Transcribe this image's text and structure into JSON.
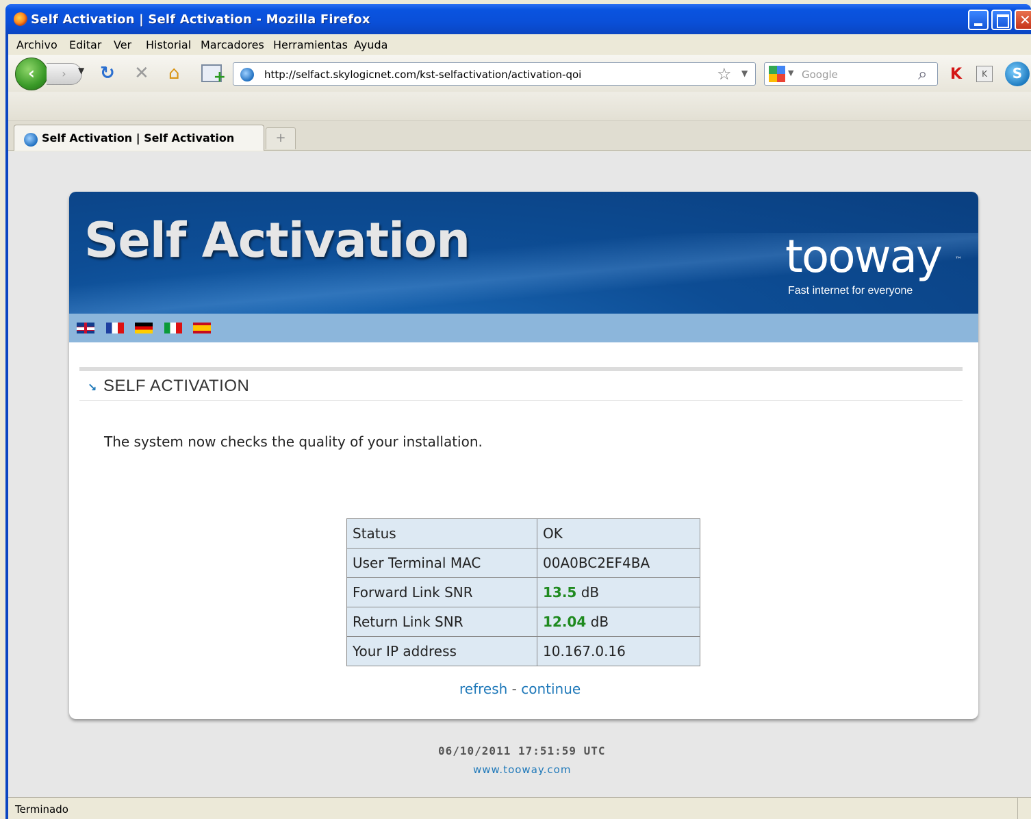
{
  "window": {
    "title": "Self Activation | Self Activation - Mozilla Firefox"
  },
  "menu": [
    "Archivo",
    "Editar",
    "Ver",
    "Historial",
    "Marcadores",
    "Herramientas",
    "Ayuda"
  ],
  "navbar": {
    "url": "http://selfact.skylogicnet.com/kst-selfactivation/activation-qoi",
    "search_placeholder": "Google"
  },
  "tabs": [
    {
      "label": "Self Activation | Self Activation",
      "active": true
    }
  ],
  "page": {
    "banner_title": "Self Activation",
    "brand": {
      "name": "tooway",
      "tm": "™",
      "tagline": "Fast internet for everyone"
    },
    "languages": [
      "en",
      "fr",
      "de",
      "it",
      "es"
    ],
    "section_title": "SELF ACTIVATION",
    "intro": "The system now checks the quality of your installation.",
    "status_table": [
      {
        "label": "Status",
        "value": "OK"
      },
      {
        "label": "User Terminal MAC",
        "value": "00A0BC2EF4BA"
      },
      {
        "label": "Forward Link SNR",
        "value": "13.5",
        "unit": "dB"
      },
      {
        "label": "Return Link SNR",
        "value": "12.04",
        "unit": "dB"
      },
      {
        "label": "Your IP address",
        "value": "10.167.0.16"
      }
    ],
    "links": {
      "refresh": "refresh",
      "separator": " - ",
      "continue": "continue"
    },
    "timestamp": "06/10/2011 17:51:59 UTC",
    "site": "www.tooway.com"
  },
  "statusbar": {
    "text": "Terminado"
  },
  "colors": {
    "accent": "#1e78b9",
    "banner": "#0d4d95",
    "good": "#1f8a1f",
    "table_bg": "#dde9f3"
  }
}
